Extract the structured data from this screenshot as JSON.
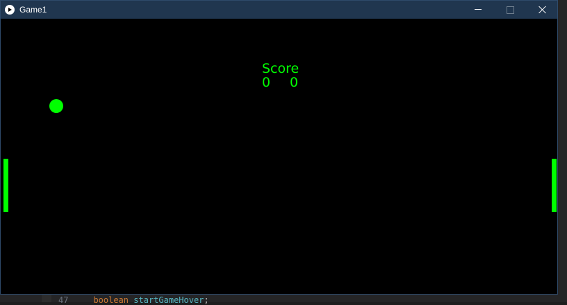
{
  "window": {
    "title": "Game1",
    "titlebar_color": "#20364f",
    "icons": {
      "app": "play-icon",
      "minimize": "minimize-icon",
      "maximize": "maximize-icon",
      "close": "close-icon"
    }
  },
  "game": {
    "background_color": "#000000",
    "accent_color": "#00ff00",
    "score": {
      "label": "Score",
      "left": "0",
      "right": "0"
    }
  },
  "editor_background": {
    "line_number": "47",
    "keyword": "boolean",
    "identifier": "startGameHover",
    "punctuation": ";"
  }
}
